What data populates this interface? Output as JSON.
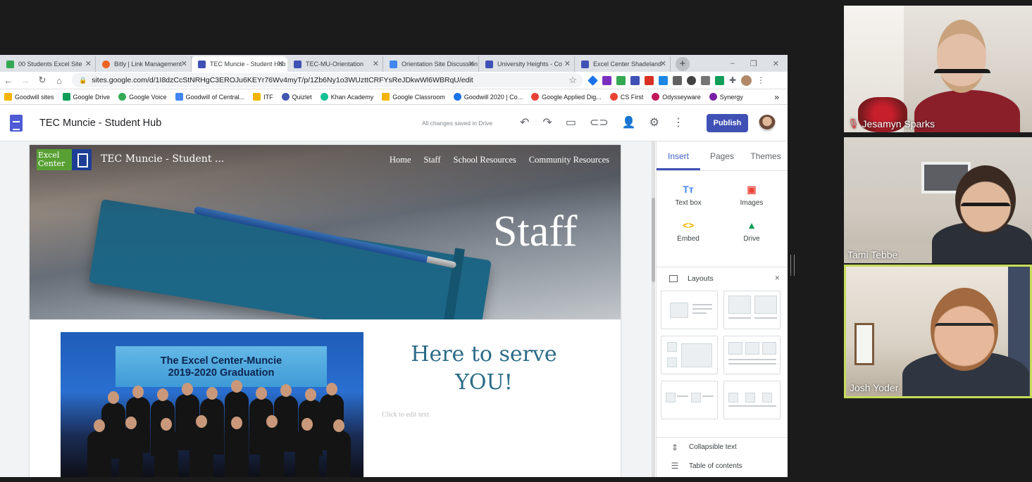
{
  "browser": {
    "tabs": [
      {
        "label": "00 Students Excel Site",
        "color": "#34a853"
      },
      {
        "label": "Bitly | Link Management",
        "color": "#ee6123"
      },
      {
        "label": "TEC Muncie - Student Hub",
        "color": "#4051b5"
      },
      {
        "label": "TEC-MU-Orientation",
        "color": "#4051b5"
      },
      {
        "label": "Orientation Site Discussion",
        "color": "#4285f4"
      },
      {
        "label": "University Heights - Co",
        "color": "#4051b5"
      },
      {
        "label": "Excel Center Shadeland",
        "color": "#4051b5"
      }
    ],
    "active_tab_index": 2,
    "new_tab": "+",
    "window_controls": [
      "–",
      "❐",
      "✕"
    ],
    "url": "sites.google.com/d/1I8dzCcStNRHgC3EROJu6KEYr76Wv4myT/p/1Zb6Ny1o3WUzttCRFYsReJDkwWl6WBRqU/edit",
    "bookmarks": [
      {
        "label": "Goodwill sites",
        "color": "#f4b400"
      },
      {
        "label": "Google Drive",
        "color": "#0f9d58"
      },
      {
        "label": "Google Voice",
        "color": "#34a853"
      },
      {
        "label": "Goodwill of Central...",
        "color": "#4285f4"
      },
      {
        "label": "ITF",
        "color": "#f4b400"
      },
      {
        "label": "Quizlet",
        "color": "#4257b2"
      },
      {
        "label": "Khan Academy",
        "color": "#14bf96"
      },
      {
        "label": "Google Classroom",
        "color": "#f4b400"
      },
      {
        "label": "Goodwill 2020 | Co...",
        "color": "#1a73e8"
      },
      {
        "label": "Google Applied Dig...",
        "color": "#ea4335"
      },
      {
        "label": "CS First",
        "color": "#ea4335"
      },
      {
        "label": "Odysseyware",
        "color": "#c2185b"
      },
      {
        "label": "Synergy",
        "color": "#7b1fa2"
      }
    ],
    "bookmarks_more": "»"
  },
  "sites": {
    "doc_title": "TEC Muncie - Student Hub",
    "save_status": "All changes saved in Drive",
    "publish_label": "Publish"
  },
  "page": {
    "logo_text": "Excel Center",
    "site_name": "TEC Muncie - Student ...",
    "nav": [
      "Home",
      "Staff",
      "School Resources",
      "Community Resources"
    ],
    "hero_title": "Staff",
    "photo_caption_line1": "The Excel Center-Muncie",
    "photo_caption_line2": "2019-2020 Graduation",
    "heading_line1": "Here to serve",
    "heading_line2": "YOU!",
    "placeholder": "Click to edit text"
  },
  "panel": {
    "tabs": [
      "Insert",
      "Pages",
      "Themes"
    ],
    "active_tab": "Insert",
    "insert_items": [
      {
        "label": "Text box",
        "icon": "Tт",
        "color": "#4285f4"
      },
      {
        "label": "Images",
        "icon": "▣",
        "color": "#ea4335"
      },
      {
        "label": "Embed",
        "icon": "<>",
        "color": "#f4b400"
      },
      {
        "label": "Drive",
        "icon": "▲",
        "color": "#0f9d58"
      }
    ],
    "layouts_label": "Layouts",
    "collapsible_label": "Collapsible text",
    "toc_label": "Table of contents"
  },
  "participants": [
    {
      "name": "Jesamyn Sparks",
      "muted": true
    },
    {
      "name": "Tami Tebbe",
      "muted": false
    },
    {
      "name": "Josh Yoder",
      "muted": false,
      "active_speaker": true
    }
  ]
}
